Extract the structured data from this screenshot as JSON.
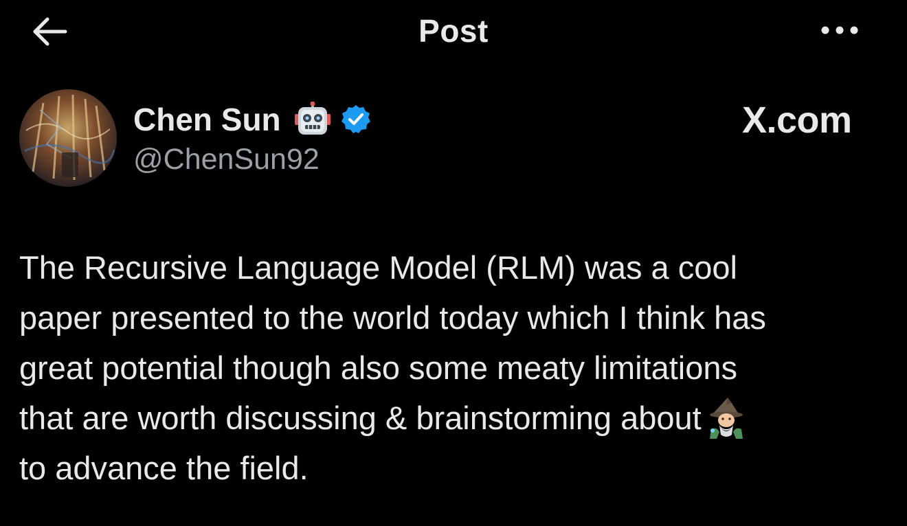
{
  "header": {
    "title": "Post",
    "back_icon": "arrow-left-icon",
    "more_icon": "more-horizontal-icon"
  },
  "author": {
    "display_name": "Chen Sun",
    "name_emoji": "robot-face-emoji",
    "verified_icon": "verified-badge-icon",
    "handle": "@ChenSun92"
  },
  "brand": {
    "label": "X.com"
  },
  "post": {
    "lines": [
      "The Recursive Language Model (RLM) was a cool",
      "paper presented to the world today which I think has",
      "great potential though also some meaty limitations",
      "that are worth discussing & brainstorming about",
      "to advance the field."
    ],
    "inline_emoji": "mage-emoji"
  },
  "colors": {
    "background": "#000000",
    "text_primary": "#e7e9ea",
    "text_secondary": "#9aa0a5",
    "verified_blue": "#1d9bf0"
  }
}
